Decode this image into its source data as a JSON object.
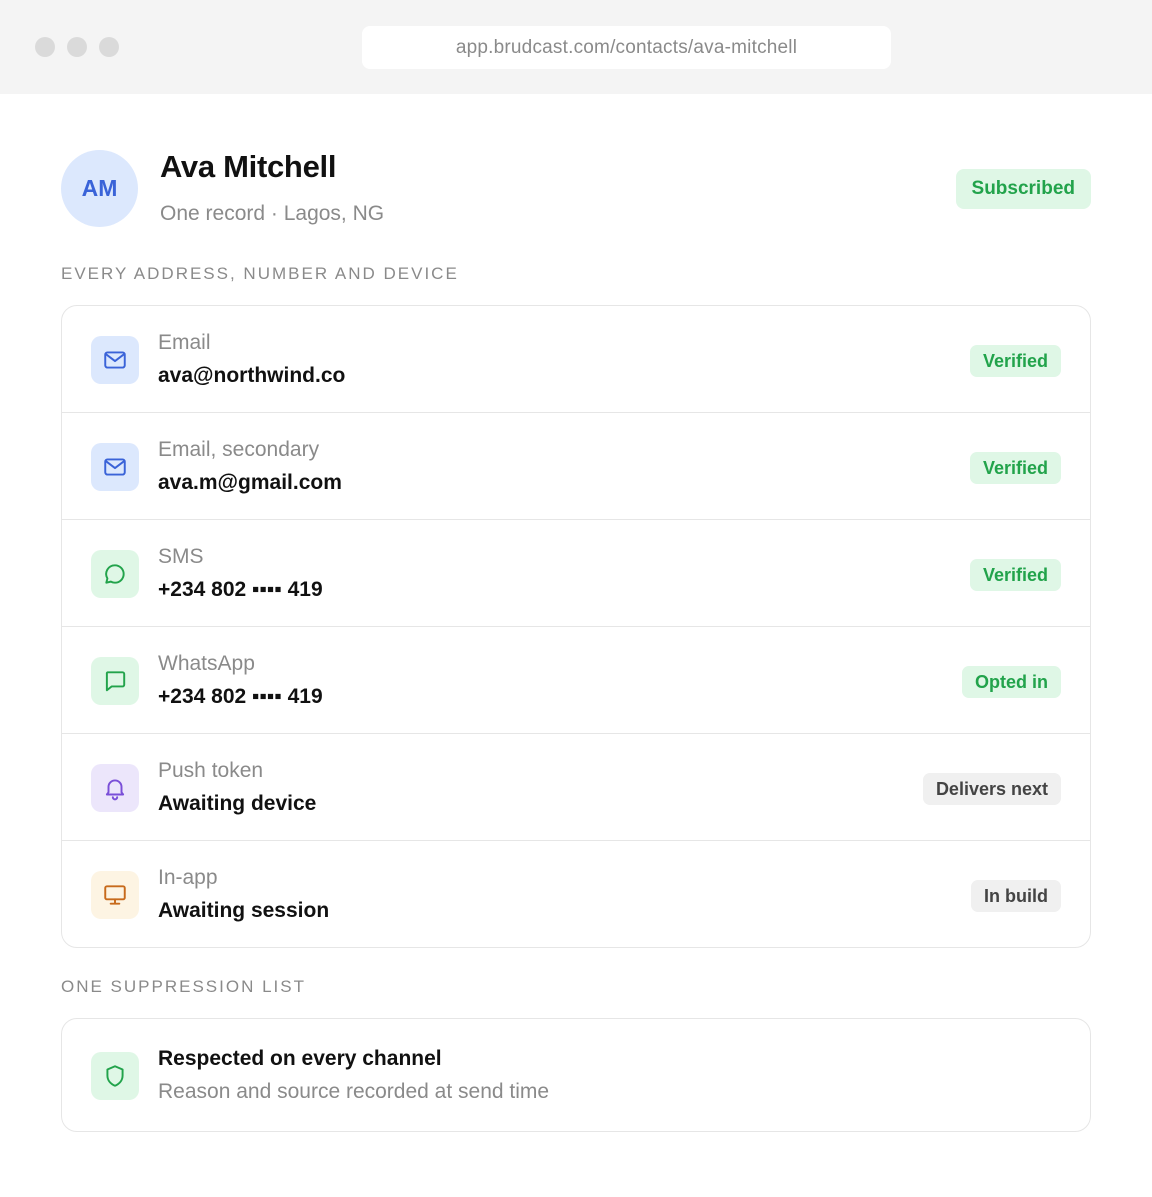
{
  "browser": {
    "url": "app.brudcast.com/contacts/ava-mitchell"
  },
  "contact": {
    "initials": "AM",
    "name": "Ava Mitchell",
    "subline": "One record · Lagos, NG",
    "status": "Subscribed"
  },
  "channels_section": {
    "label": "EVERY ADDRESS, NUMBER AND DEVICE",
    "items": [
      {
        "label": "Email",
        "value": "ava@northwind.co",
        "status": "Verified",
        "icon": "mail-icon"
      },
      {
        "label": "Email, secondary",
        "value": "ava.m@gmail.com",
        "status": "Verified",
        "icon": "mail-icon"
      },
      {
        "label": "SMS",
        "value": "+234 802 ▪▪▪▪ 419",
        "status": "Verified",
        "icon": "message-circle-icon"
      },
      {
        "label": "WhatsApp",
        "value": "+234 802 ▪▪▪▪ 419",
        "status": "Opted in",
        "icon": "message-square-icon"
      },
      {
        "label": "Push token",
        "value": "Awaiting device",
        "status": "Delivers next",
        "icon": "bell-icon"
      },
      {
        "label": "In-app",
        "value": "Awaiting session",
        "status": "In build",
        "icon": "monitor-icon"
      }
    ]
  },
  "suppression_section": {
    "label": "ONE SUPPRESSION LIST",
    "title": "Respected on every channel",
    "description": "Reason and source recorded at send time",
    "icon": "shield-icon"
  },
  "colors": {
    "accent_blue": "#3a63d8",
    "success_green": "#22a34b",
    "push_purple": "#7a4fd8",
    "inapp_orange": "#c76a1c"
  }
}
